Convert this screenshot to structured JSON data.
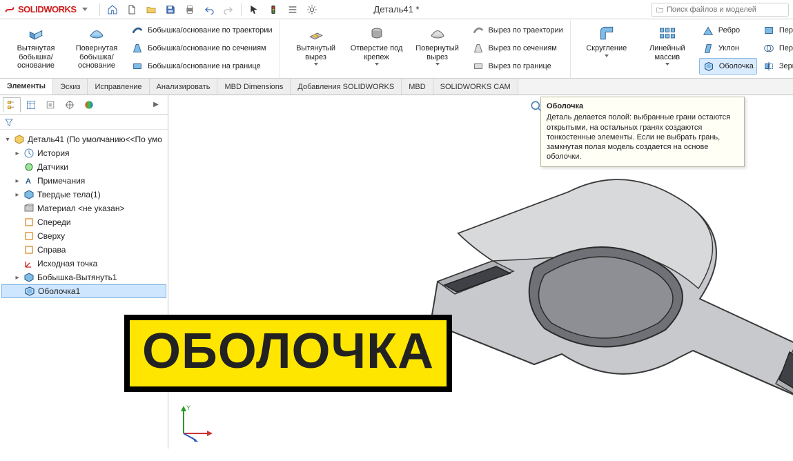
{
  "app": {
    "brand": "SOLIDWORKS",
    "doc_title": "Деталь41 *",
    "search_placeholder": "Поиск файлов и моделей"
  },
  "ribbon": {
    "extrude_boss": "Вытянутая бобышка/основание",
    "revolve_boss": "Повернутая бобышка/основание",
    "swept_boss": "Бобышка/основание по траектории",
    "lofted_boss": "Бобышка/основание по сечениям",
    "boundary_boss": "Бобышка/основание на границе",
    "extrude_cut": "Вытянутый вырез",
    "hole_wizard": "Отверстие под крепеж",
    "revolve_cut": "Повернутый вырез",
    "swept_cut": "Вырез по траектории",
    "lofted_cut": "Вырез по сечениям",
    "boundary_cut": "Вырез по границе",
    "fillet": "Скругление",
    "linear_pattern": "Линейный массив",
    "rib": "Ребро",
    "draft": "Уклон",
    "shell": "Оболочка",
    "wrap": "Перен",
    "intersect": "Пересе",
    "mirror": "Зеркал"
  },
  "tabs": {
    "t1": "Элементы",
    "t2": "Эскиз",
    "t3": "Исправление",
    "t4": "Анализировать",
    "t5": "MBD Dimensions",
    "t6": "Добавления SOLIDWORKS",
    "t7": "MBD",
    "t8": "SOLIDWORKS CAM"
  },
  "tree": {
    "root": "Деталь41  (По умолчанию<<По умо",
    "history": "История",
    "sensors": "Датчики",
    "annotations": "Примечания",
    "solid_bodies": "Твердые тела(1)",
    "material": "Материал <не указан>",
    "front": "Спереди",
    "top": "Сверху",
    "right": "Справа",
    "origin": "Исходная точка",
    "feat1": "Бобышка-Вытянуть1",
    "feat2": "Оболочка1"
  },
  "tooltip": {
    "title": "Оболочка",
    "body": "Деталь делается полой: выбранные грани остаются открытыми, на остальных гранях создаются тонкостенные элементы. Если не выбрать грань, замкнутая полая модель создается на основе оболочки."
  },
  "overlay": "ОБОЛОЧКА"
}
